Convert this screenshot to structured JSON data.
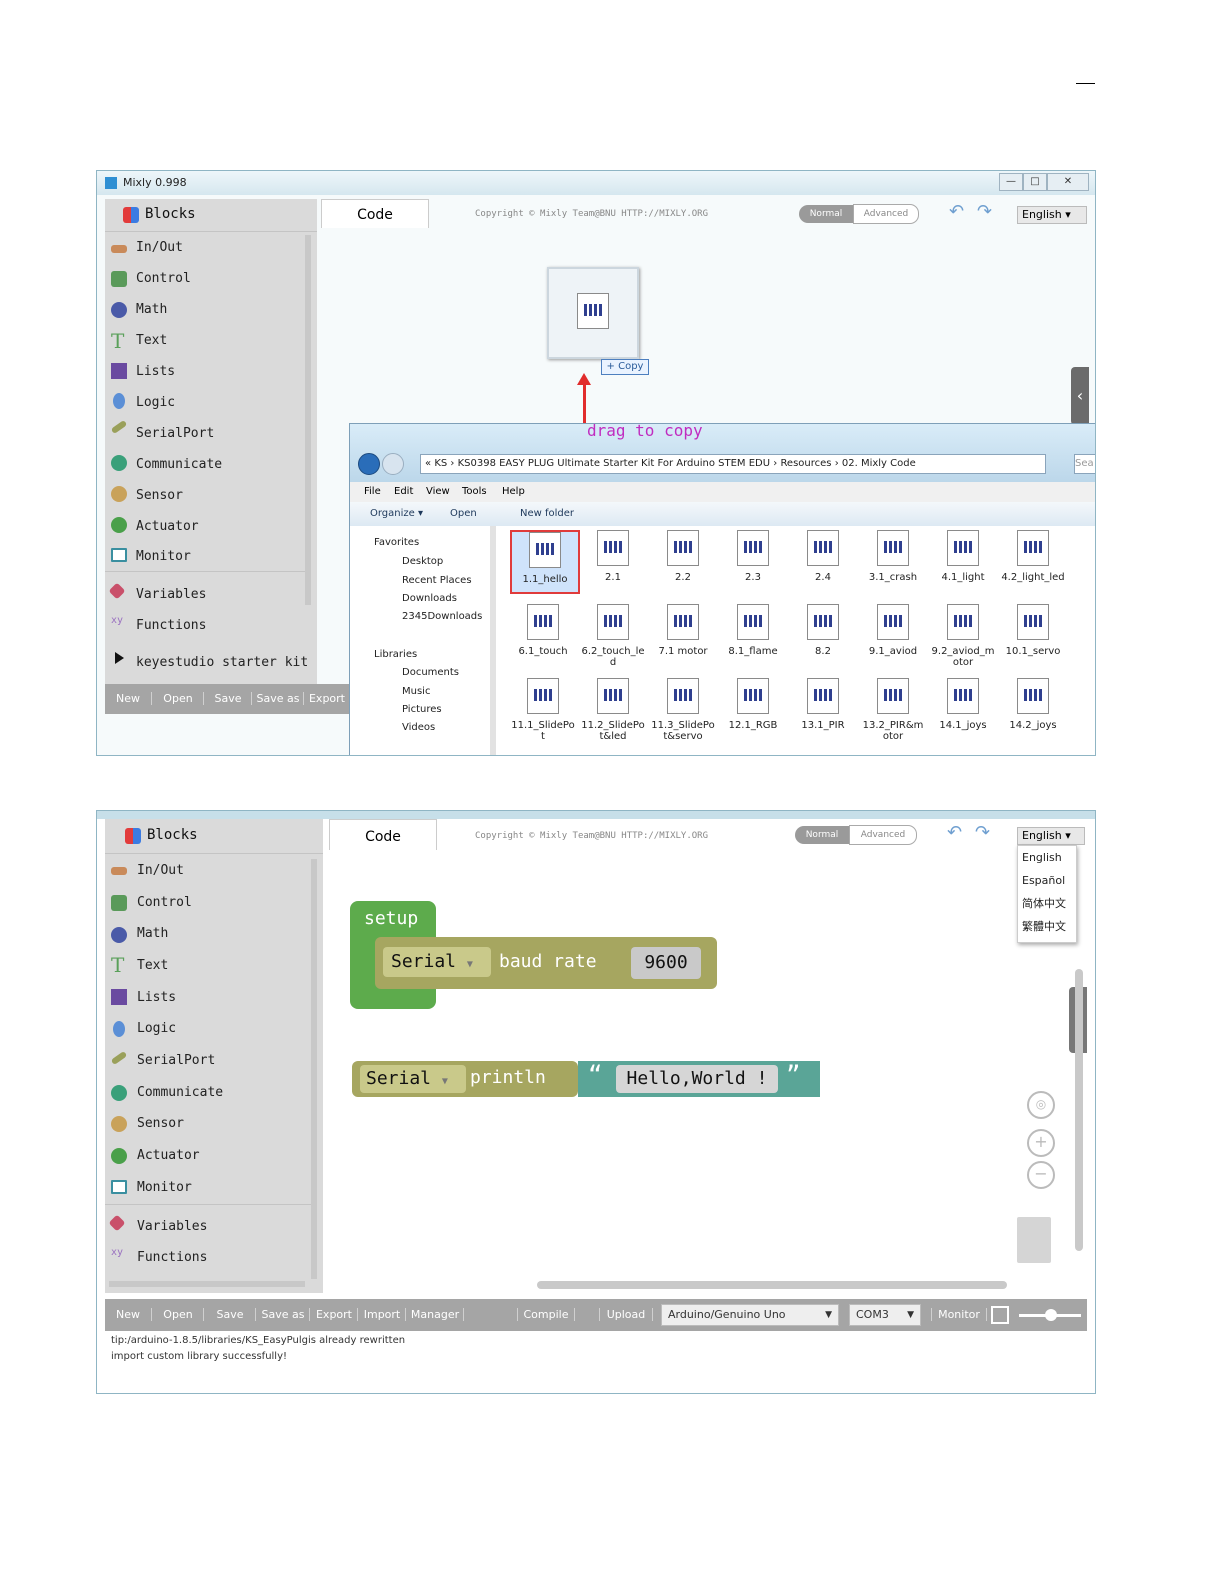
{
  "shot1": {
    "window_title": "Mixly 0.998",
    "window_buttons": [
      "—",
      "□",
      "✕"
    ],
    "blocks_header": "Blocks",
    "tab_code": "Code",
    "copyright": "Copyright © Mixly Team@BNU HTTP://MIXLY.ORG",
    "mode_normal": "Normal",
    "mode_advanced": "Advanced",
    "language": "English",
    "categories": [
      "In/Out",
      "Control",
      "Math",
      "Text",
      "Lists",
      "Logic",
      "SerialPort",
      "Communicate",
      "Sensor",
      "Actuator",
      "Monitor",
      "Variables",
      "Functions",
      "keyestudio starter kit"
    ],
    "buttons": [
      "New",
      "Open",
      "Save",
      "Save as",
      "Export"
    ],
    "copy_tooltip": "+ Copy",
    "annotation": "drag to copy",
    "explorer": {
      "breadcrumb": [
        "«",
        "KS",
        "KS0398 EASY PLUG Ultimate Starter Kit For Arduino STEM EDU",
        "Resources",
        "02. Mixly Code"
      ],
      "search_placeholder": "Sea",
      "menu": [
        "File",
        "Edit",
        "View",
        "Tools",
        "Help"
      ],
      "toolbar": [
        "Organize ▾",
        "Open",
        "New folder"
      ],
      "nav": [
        "Favorites",
        "Desktop",
        "Recent Places",
        "Downloads",
        "2345Downloads",
        "Libraries",
        "Documents",
        "Music",
        "Pictures",
        "Videos"
      ],
      "files_row1": [
        "1.1_hello",
        "2.1",
        "2.2",
        "2.3",
        "2.4",
        "3.1_crash",
        "4.1_light",
        "4.2_light_led"
      ],
      "files_row2": [
        "6.1_touch",
        "6.2_touch_led",
        "7.1 motor",
        "8.1_flame",
        "8.2",
        "9.1_aviod",
        "9.2_aviod_motor",
        "10.1_servo"
      ],
      "files_row3": [
        "11.1_SlidePot",
        "11.2_SlidePot&led",
        "11.3_SlidePot&servo",
        "12.1_RGB",
        "13.1_PIR",
        "13.2_PIR&motor",
        "14.1_joys",
        "14.2_joys"
      ]
    }
  },
  "shot2": {
    "blocks_header": "Blocks",
    "tab_code": "Code",
    "copyright": "Copyright © Mixly Team@BNU HTTP://MIXLY.ORG",
    "mode_normal": "Normal",
    "mode_advanced": "Advanced",
    "language": "English",
    "language_options": [
      "English",
      "Español",
      "简体中文",
      "繁體中文"
    ],
    "categories": [
      "In/Out",
      "Control",
      "Math",
      "Text",
      "Lists",
      "Logic",
      "SerialPort",
      "Communicate",
      "Sensor",
      "Actuator",
      "Monitor",
      "Variables",
      "Functions"
    ],
    "blocks": {
      "setup": "setup",
      "serial_dd": "Serial",
      "baud_rate": "baud rate",
      "baud_value": "9600",
      "serial_dd2": "Serial",
      "println": "println",
      "open_quote": "“",
      "text_value": "Hello,World !",
      "close_quote": "”"
    },
    "buttons": [
      "New",
      "Open",
      "Save",
      "Save as",
      "Export",
      "Import",
      "Manager"
    ],
    "compile": "Compile",
    "upload": "Upload",
    "board": "Arduino/Genuino Uno",
    "port": "COM3",
    "monitor": "Monitor",
    "status_lines": [
      "tip:/arduino-1.8.5/libraries/KS_EasyPulgis already rewritten",
      "import custom library successfully!"
    ]
  }
}
